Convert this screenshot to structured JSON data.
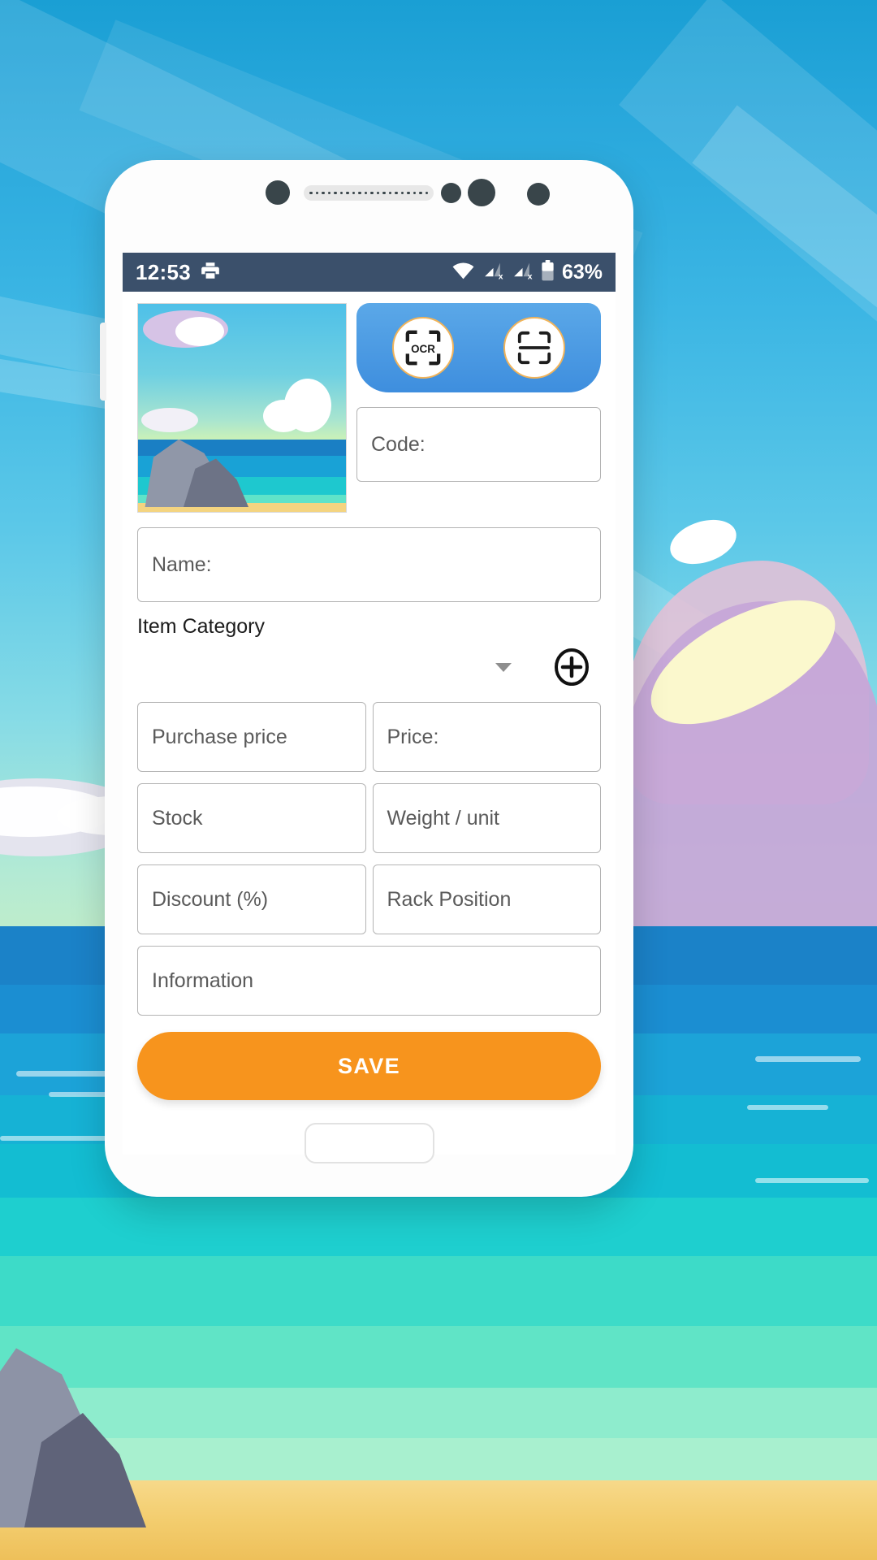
{
  "status_bar": {
    "time": "12:53",
    "printer_icon": "printer-icon",
    "wifi_icon": "wifi-icon",
    "signal_1_icon": "signal-no-sim-icon",
    "signal_2_icon": "signal-no-sim-icon",
    "battery_icon": "battery-icon",
    "battery_percent": "63%"
  },
  "actions": {
    "ocr_label": "OCR",
    "ocr_icon": "ocr-scan-icon",
    "barcode_icon": "barcode-scan-icon",
    "panel_color": "#4a97e2",
    "ring_color": "#f0b35a"
  },
  "thumbnail": {
    "name": "item-photo-thumbnail"
  },
  "form": {
    "code": {
      "label": "Code:",
      "value": ""
    },
    "name": {
      "label": "Name:",
      "value": ""
    },
    "category": {
      "label": "Item Category",
      "selected": "",
      "add_icon": "plus-circle-icon",
      "caret_icon": "chevron-down-icon"
    },
    "purchase_price": {
      "label": "Purchase price",
      "value": ""
    },
    "price": {
      "label": "Price:",
      "value": ""
    },
    "stock": {
      "label": "Stock",
      "value": ""
    },
    "weight_unit": {
      "label": "Weight / unit",
      "value": ""
    },
    "discount": {
      "label": "Discount (%)",
      "value": ""
    },
    "rack_position": {
      "label": "Rack Position",
      "value": ""
    },
    "information": {
      "label": "Information",
      "value": ""
    }
  },
  "save_button": {
    "label": "SAVE",
    "color": "#f7941d"
  },
  "navigation": {
    "home_indicator": "home-indicator"
  },
  "device": {
    "front_camera": "front-camera-dot",
    "earpiece": "earpiece-speaker",
    "sensor_1": "proximity-sensor-dot",
    "sensor_2": "sensor-dot",
    "sensor_3": "sensor-dot"
  }
}
